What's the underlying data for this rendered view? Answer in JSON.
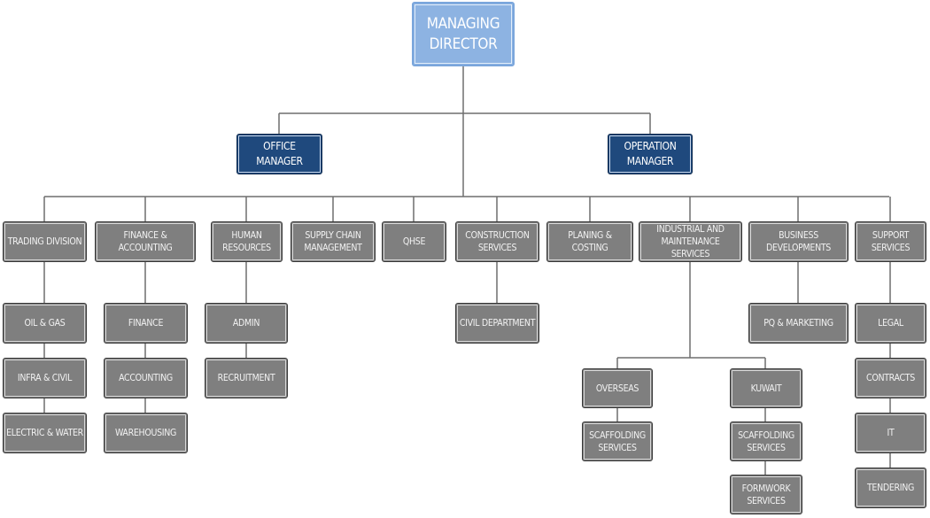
{
  "managing_director": "MANAGING\nDIRECTOR",
  "office_manager": "OFFICE\nMANAGER",
  "operation_manager": "OPERATION\nMANAGER",
  "departments": {
    "trading": {
      "label": "TRADING DIVISION",
      "children": [
        "OIL & GAS",
        "INFRA & CIVIL",
        "ELECTRIC & WATER"
      ]
    },
    "finance_accounting": {
      "label": "FINANCE & ACCOUNTING",
      "children": [
        "FINANCE",
        "ACCOUNTING",
        "WAREHOUSING"
      ]
    },
    "hr": {
      "label": "HUMAN\nRESOURCES",
      "children": [
        "ADMIN",
        "RECRUITMENT"
      ]
    },
    "supply_chain": {
      "label": "SUPPLY CHAIN\nMANAGEMENT"
    },
    "qhse": {
      "label": "QHSE"
    },
    "construction": {
      "label": "CONSTRUCTION\nSERVICES",
      "children": [
        "CIVIL DEPARTMENT"
      ]
    },
    "planing": {
      "label": "PLANING & COSTING"
    },
    "industrial": {
      "label": "INDUSTRIAL AND\nMAINTENANCE SERVICES",
      "overseas": {
        "label": "OVERSEAS",
        "children": [
          "SCAFFOLDING\nSERVICES"
        ]
      },
      "kuwait": {
        "label": "KUWAIT",
        "children": [
          "SCAFFOLDING\nSERVICES",
          "FORMWORK\nSERVICES"
        ]
      }
    },
    "business": {
      "label": "BUSINESS\nDEVELOPMENTS",
      "children": [
        "PQ & MARKETING"
      ]
    },
    "support": {
      "label": "SUPPORT\nSERVICES",
      "children": [
        "LEGAL",
        "CONTRACTS",
        "IT",
        "TENDERING"
      ]
    }
  },
  "colors": {
    "director": "#8db3e2",
    "manager": "#1f497d",
    "department": "#7f7f7f",
    "connector": "#6e6e6e"
  }
}
